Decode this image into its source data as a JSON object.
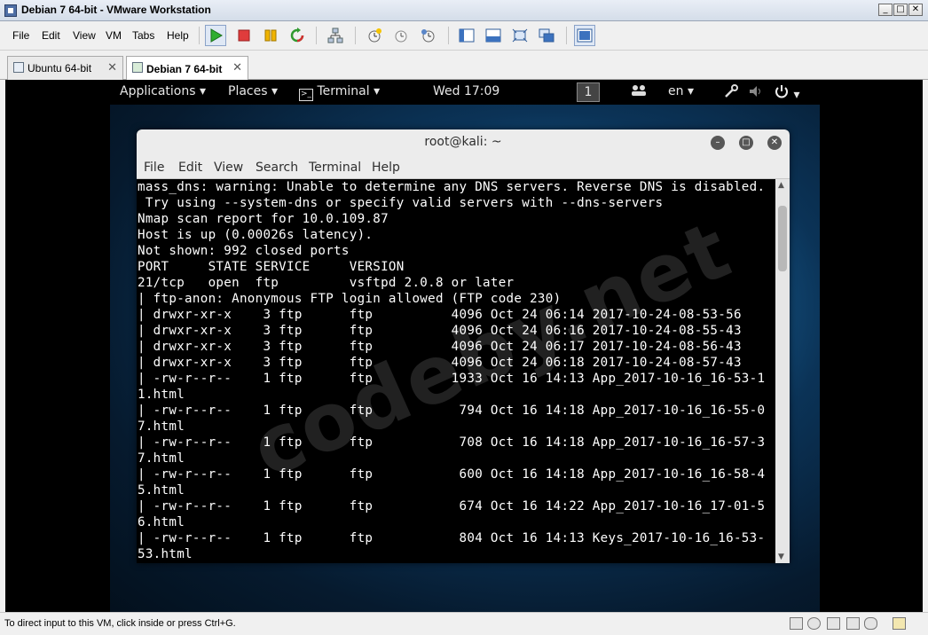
{
  "window": {
    "title": "Debian 7 64-bit - VMware Workstation"
  },
  "menu": [
    "File",
    "Edit",
    "View",
    "VM",
    "Tabs",
    "Help"
  ],
  "toolbar_icons": [
    "power-on-icon",
    "power-off-icon",
    "suspend-icon",
    "reset-icon",
    "network-icon",
    "snapshot-icon",
    "revert-snapshot-icon",
    "snapshot-manager-icon",
    "show-sidebar-icon",
    "show-console-icon",
    "full-screen-icon",
    "unity-icon",
    "console-view-icon"
  ],
  "tabs": [
    {
      "label": "Ubuntu 64-bit",
      "active": false
    },
    {
      "label": "Debian 7 64-bit",
      "active": true
    }
  ],
  "gnome": {
    "applications": "Applications",
    "places": "Places",
    "terminal": "Terminal",
    "clock": "Wed 17:09",
    "workspace": "1",
    "lang": "en"
  },
  "terminal": {
    "title": "root@kali: ~",
    "menu": [
      "File",
      "Edit",
      "View",
      "Search",
      "Terminal",
      "Help"
    ],
    "lines": [
      "mass_dns: warning: Unable to determine any DNS servers. Reverse DNS is disabled.",
      " Try using --system-dns or specify valid servers with --dns-servers",
      "Nmap scan report for 10.0.109.87",
      "Host is up (0.00026s latency).",
      "Not shown: 992 closed ports",
      "PORT     STATE SERVICE     VERSION",
      "21/tcp   open  ftp         vsftpd 2.0.8 or later",
      "| ftp-anon: Anonymous FTP login allowed (FTP code 230)",
      "| drwxr-xr-x    3 ftp      ftp          4096 Oct 24 06:14 2017-10-24-08-53-56",
      "| drwxr-xr-x    3 ftp      ftp          4096 Oct 24 06:16 2017-10-24-08-55-43",
      "| drwxr-xr-x    3 ftp      ftp          4096 Oct 24 06:17 2017-10-24-08-56-43",
      "| drwxr-xr-x    3 ftp      ftp          4096 Oct 24 06:18 2017-10-24-08-57-43",
      "| -rw-r--r--    1 ftp      ftp          1933 Oct 16 14:13 App_2017-10-16_16-53-1",
      "1.html",
      "| -rw-r--r--    1 ftp      ftp           794 Oct 16 14:18 App_2017-10-16_16-55-0",
      "7.html",
      "| -rw-r--r--    1 ftp      ftp           708 Oct 16 14:18 App_2017-10-16_16-57-3",
      "7.html",
      "| -rw-r--r--    1 ftp      ftp           600 Oct 16 14:18 App_2017-10-16_16-58-4",
      "5.html",
      "| -rw-r--r--    1 ftp      ftp           674 Oct 16 14:22 App_2017-10-16_17-01-5",
      "6.html",
      "| -rw-r--r--    1 ftp      ftp           804 Oct 16 14:13 Keys_2017-10-16_16-53-",
      "53.html"
    ]
  },
  "watermark": "codeby.net",
  "status": {
    "text": "To direct input to this VM, click inside or press Ctrl+G."
  },
  "colors": {
    "terminal_bg": "#000000",
    "terminal_fg": "#ffffff",
    "titlebar": "#dbe3ee"
  }
}
